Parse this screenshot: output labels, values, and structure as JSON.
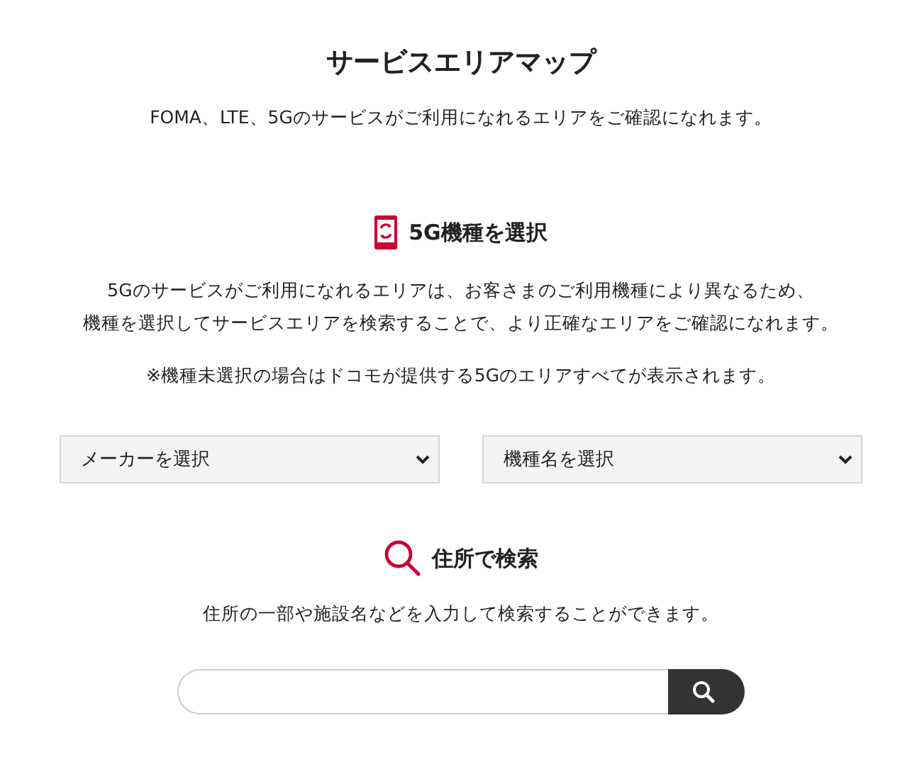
{
  "title": "サービスエリアマップ",
  "subtitle": "FOMA、LTE、5Gのサービスがご利用になれるエリアをご確認になれます。",
  "model_section": {
    "heading": "5G機種を選択",
    "description": [
      "5Gのサービスがご利用になれるエリアは、お客さまのご利用機種により異なるため、",
      "機種を選択してサービスエリアを検索することで、より正確なエリアをご確認になれます。"
    ],
    "note": "※機種未選択の場合はドコモが提供する5Gのエリアすべてが表示されます。",
    "dropdowns": [
      {
        "placeholder": "メーカーを選択"
      },
      {
        "placeholder": "機種名を選択"
      }
    ]
  },
  "address_section": {
    "heading": "住所で検索",
    "description": "住所の一部や施設名などを入力して検索することができます。"
  }
}
